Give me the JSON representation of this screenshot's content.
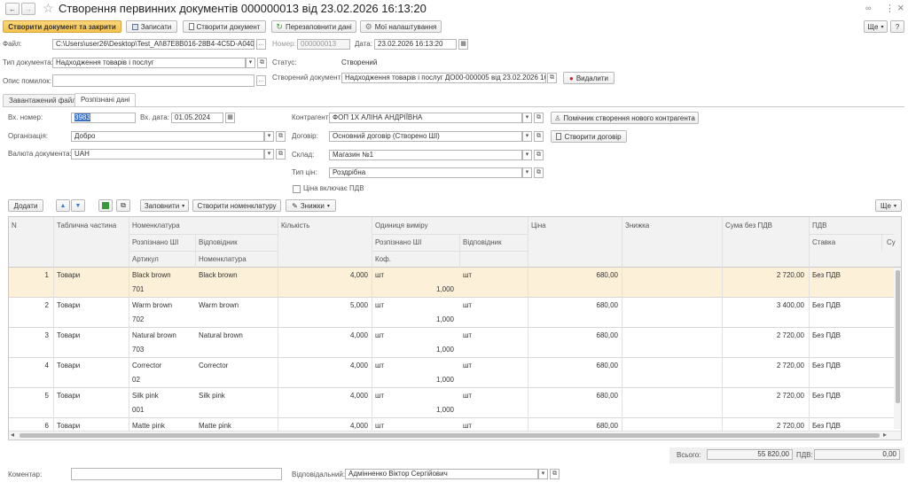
{
  "window": {
    "title": "Створення первинних документів 000000013 від 23.02.2026 16:13:20",
    "more_label": "Ще",
    "more_caret": "▾"
  },
  "toolbar": {
    "create_close": "Створити документ та закрити",
    "save": "Записати",
    "create_doc": "Створити документ",
    "refill": "Перезаповнити дані",
    "my_settings": "Мої налаштування"
  },
  "header": {
    "file_label": "Файл:",
    "file_value": "C:\\Users\\user26\\Desktop\\Test_AI\\87E8B016-28B4-4C5D-A040-10(",
    "number_label": "Номер:",
    "number_value": "000000013",
    "date_label": "Дата:",
    "date_value": "23.02.2026 16:13:20",
    "doctype_label": "Тип документа:",
    "doctype_value": "Надходження товарів і послуг",
    "status_label": "Статус:",
    "status_value": "Створений",
    "errors_label": "Опис помилок:",
    "errors_value": "",
    "created_label": "Створений документ:",
    "created_value": "Надходження товарів і послуг ДО00-000005 від 23.02.2026 16:1",
    "delete_label": "Видалити"
  },
  "tabs": [
    "Завантажений файл",
    "Розпізнані дані"
  ],
  "form": {
    "in_number_label": "Вх. номер:",
    "in_number_value": "3983",
    "in_date_label": "Вх. дата:",
    "in_date_value": "01.05.2024",
    "org_label": "Організація:",
    "org_value": "Добро",
    "currency_label": "Валюта документа:",
    "currency_value": "UAH",
    "contractor_label": "Контрагент:",
    "contractor_value": "ФОП          1Х АЛІНА АНДРІЇВНА",
    "helper_label": "Помічник створення нового контрагента",
    "contract_label": "Договір:",
    "contract_value": "Основний договір (Створено ШІ)",
    "create_contract_label": "Створити договір",
    "warehouse_label": "Склад:",
    "warehouse_value": "Магазин №1",
    "price_type_label": "Тип цін:",
    "price_type_value": "Роздрібна",
    "vat_incl_label": "Ціна включає ПДВ"
  },
  "table_toolbar": {
    "add": "Додати",
    "fill": "Заповнити",
    "create_nom": "Створити номенклатуру",
    "discounts": "Знижки",
    "more": "Ще"
  },
  "table": {
    "headers": {
      "n": "N",
      "tab_part": "Таблична частина",
      "nomenclature": "Номенклатура",
      "recognized_ai": "Розпізнано ШІ",
      "matching": "Відповідник",
      "article": "Артикул",
      "nom_sub": "Номенклатура",
      "quantity": "Кількість",
      "unit": "Одиниця виміру",
      "unit_ai": "Розпізнано ШІ",
      "unit_match": "Відповідник",
      "coef": "Коф.",
      "price": "Ціна",
      "discount": "Знижка",
      "sum_no_vat": "Сума без ПДВ",
      "vat": "ПДВ",
      "rate": "Ставка",
      "su": "Су"
    },
    "rows": [
      {
        "n": "1",
        "part": "Товари",
        "ai": "Black brown",
        "match": "Black brown",
        "art": "701",
        "qty": "4,000",
        "unit_ai": "шт",
        "coef": "1,000",
        "unit_match": "шт",
        "price": "680,00",
        "sum": "2 720,00",
        "rate": "Без ПДВ"
      },
      {
        "n": "2",
        "part": "Товари",
        "ai": "Warm brown",
        "match": "Warm brown",
        "art": "702",
        "qty": "5,000",
        "unit_ai": "шт",
        "coef": "1,000",
        "unit_match": "шт",
        "price": "680,00",
        "sum": "3 400,00",
        "rate": "Без ПДВ"
      },
      {
        "n": "3",
        "part": "Товари",
        "ai": "Natural brown",
        "match": "Natural brown",
        "art": "703",
        "qty": "4,000",
        "unit_ai": "шт",
        "coef": "1,000",
        "unit_match": "шт",
        "price": "680,00",
        "sum": "2 720,00",
        "rate": "Без ПДВ"
      },
      {
        "n": "4",
        "part": "Товари",
        "ai": "Corrector",
        "match": "Corrector",
        "art": "02",
        "qty": "4,000",
        "unit_ai": "шт",
        "coef": "1,000",
        "unit_match": "шт",
        "price": "680,00",
        "sum": "2 720,00",
        "rate": "Без ПДВ"
      },
      {
        "n": "5",
        "part": "Товари",
        "ai": "Silk pink",
        "match": "Silk pink",
        "art": "001",
        "qty": "4,000",
        "unit_ai": "шт",
        "coef": "1,000",
        "unit_match": "шт",
        "price": "680,00",
        "sum": "2 720,00",
        "rate": "Без ПДВ"
      },
      {
        "n": "6",
        "part": "Товари",
        "ai": "Matte pink",
        "match": "Matte pink",
        "art": "",
        "qty": "4,000",
        "unit_ai": "шт",
        "coef": "",
        "unit_match": "шт",
        "price": "680,00",
        "sum": "2 720,00",
        "rate": "Без ПДВ"
      }
    ]
  },
  "totals": {
    "total_label": "Всього:",
    "total_value": "55 820,00",
    "vat_label": "ПДВ:",
    "vat_value": "0,00"
  },
  "footer": {
    "comment_label": "Коментар:",
    "comment_value": "",
    "responsible_label": "Відповідальний:",
    "responsible_value": "Адмінненко Віктор Сергійович"
  },
  "glyphs": {
    "back": "←",
    "forward": "→",
    "star": "☆",
    "link": "🔗",
    "kebab": "⋮",
    "close": "×",
    "caret": "▾",
    "dots": "...",
    "clip": "⧉",
    "x": "×",
    "calendar": "▦",
    "up": "▲",
    "down": "▼",
    "left": "◂",
    "right": "▸"
  },
  "colors": {
    "primary": "#f5c24c",
    "selected_row": "#fdf0d8",
    "title": "#222222"
  }
}
